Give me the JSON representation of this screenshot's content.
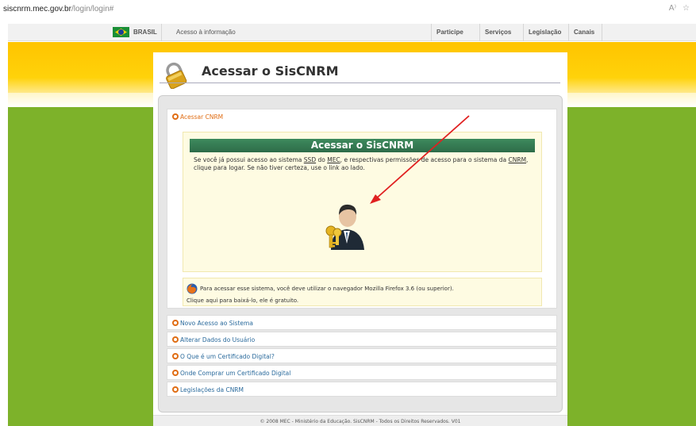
{
  "browser": {
    "url_host": "siscnrm.mec.gov.br",
    "url_path": "/login/login#"
  },
  "govbar": {
    "brasil": "BRASIL",
    "access_info": "Acesso à informação",
    "nav": [
      "Participe",
      "Serviços",
      "Legislação",
      "Canais"
    ]
  },
  "page": {
    "title": "Acessar o SisCNRM"
  },
  "accordion_open": {
    "label": "Acessar CNRM",
    "box_title": "Acessar o SisCNRM",
    "text_before_ssd": "Se você já possui acesso ao sistema ",
    "ssd": "SSD",
    "text_between": " do ",
    "mec": "MEC",
    "text_after_mec": ", e respectivas permissões de acesso para o sistema da ",
    "cnrm": "CNRM",
    "text_end": ", clique para logar. Se não tiver certeza, use o link ao lado."
  },
  "firefox": {
    "line1": "Para acessar esse sistema, você deve utilizar o navegador Mozilla Firefox 3.6 (ou superior).",
    "line2": "Clique aqui para baixá-lo, ele é gratuito."
  },
  "accordion_items": [
    "Novo Acesso ao Sistema",
    "Alterar Dados do Usuário",
    "O Que é um Certificado Digital?",
    "Onde Comprar um Certificado Digital",
    "Legislações da CNRM"
  ],
  "footer": {
    "text": "© 2008 MEC - Ministério da Educação. SisCNRM - Todos os Direitos Reservados. V01"
  },
  "colors": {
    "green_bg": "#7db22a",
    "yellow_band": "#ffc400",
    "title_bar": "#2e6c49",
    "link": "#2a6a9c",
    "bullet": "#e06d14",
    "arrow": "#e02020"
  }
}
